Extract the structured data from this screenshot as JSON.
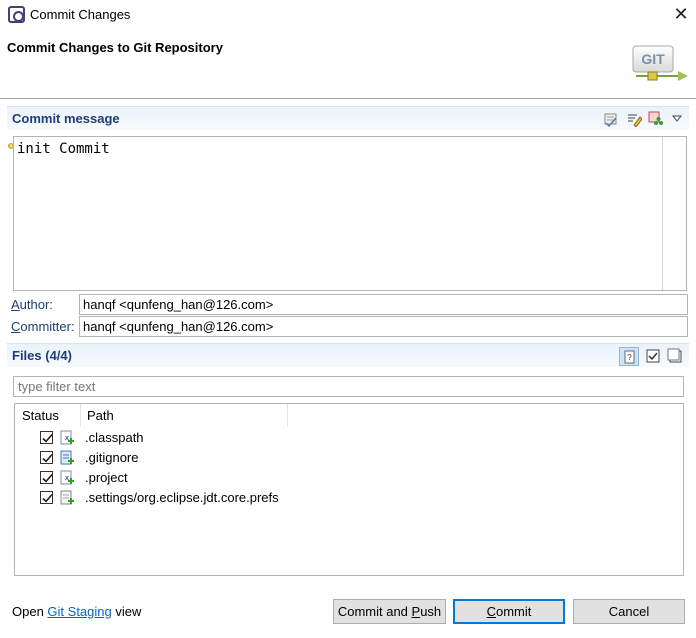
{
  "window": {
    "title": "Commit Changes",
    "close_glyph": "✕"
  },
  "header": {
    "title": "Commit Changes to Git Repository",
    "logo_text": "GIT"
  },
  "commit_message": {
    "section_title": "Commit message",
    "text": "init Commit",
    "toolbar_icons": [
      "spell-check-icon",
      "format-icon",
      "signed-off-icon",
      "view-menu-icon"
    ]
  },
  "author": {
    "label_first": "A",
    "label_rest": "uthor:",
    "value": "hanqf <qunfeng_han@126.com>"
  },
  "committer": {
    "label_first": "C",
    "label_rest": "ommitter:",
    "value": "hanqf <qunfeng_han@126.com>"
  },
  "files": {
    "section_title": "Files (4/4)",
    "filter_placeholder": "type filter text",
    "columns": {
      "status": "Status",
      "path": "Path"
    },
    "rows": [
      {
        "name": ".classpath",
        "checked": true,
        "icon": "xml-file-added-icon"
      },
      {
        "name": ".gitignore",
        "checked": true,
        "icon": "text-file-added-icon"
      },
      {
        "name": ".project",
        "checked": true,
        "icon": "xml-file-added-icon"
      },
      {
        "name": ".settings/org.eclipse.jdt.core.prefs",
        "checked": true,
        "icon": "file-added-icon"
      }
    ]
  },
  "footer": {
    "open_text": "Open ",
    "link_text": "Git Staging",
    "view_text": " view"
  },
  "buttons": {
    "commit_push_pre": "Commit and ",
    "commit_push_u": "P",
    "commit_push_post": "ush",
    "commit_u": "C",
    "commit_post": "ommit",
    "cancel": "Cancel"
  },
  "colors": {
    "section_title": "#1f3e74",
    "link": "#0066cc",
    "default_button_border": "#0078d7"
  }
}
